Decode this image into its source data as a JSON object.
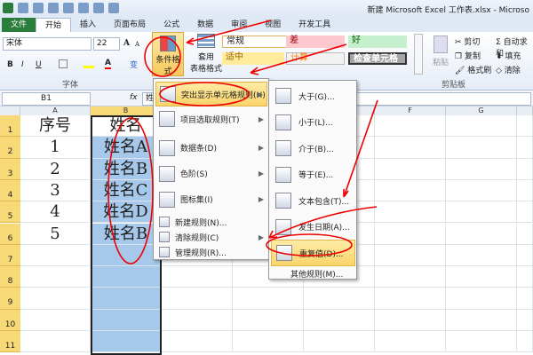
{
  "window": {
    "title": "新建 Microsoft Excel 工作表.xlsx - Microso"
  },
  "tabs": [
    "文件",
    "开始",
    "插入",
    "页面布局",
    "公式",
    "数据",
    "审阅",
    "视图",
    "开发工具"
  ],
  "ribbon": {
    "font_name": "宋体",
    "font_size": "22",
    "bold": "B",
    "italic": "I",
    "underline": "U",
    "font_color": "A",
    "grow": "A",
    "shrink": "A",
    "phonetic": "变",
    "font_group": "字体",
    "cond_format": "条件格式",
    "table_format_1": "套用",
    "table_format_2": "表格格式",
    "styles": {
      "normal": "常规",
      "bad": "差",
      "good": "好",
      "neutral": "适中",
      "calc": "计算",
      "check": "检查单元格"
    },
    "paste": "粘贴",
    "cut": "剪切",
    "copy": "复制",
    "format_painter": "格式刷",
    "clipboard_group": "剪贴板",
    "autosum": "自动求和",
    "fill": "填充",
    "clear": "清除"
  },
  "formula_bar": {
    "name_box": "B1",
    "fx": "fx",
    "content": "姓"
  },
  "columns": [
    "A",
    "B",
    "F",
    "G"
  ],
  "rows": [
    "1",
    "2",
    "3",
    "4",
    "5",
    "6",
    "7",
    "8",
    "9",
    "10",
    "11"
  ],
  "cells": {
    "A": [
      "序号",
      "1",
      "2",
      "3",
      "4",
      "5"
    ],
    "B": [
      "姓名",
      "姓名A",
      "姓名B",
      "姓名C",
      "姓名D",
      "姓名B"
    ]
  },
  "menu": [
    "突出显示单元格规则(H)",
    "项目选取规则(T)",
    "数据条(D)",
    "色阶(S)",
    "图标集(I)",
    "新建规则(N)...",
    "清除规则(C)",
    "管理规则(R)..."
  ],
  "submenu": [
    "大于(G)...",
    "小于(L)...",
    "介于(B)...",
    "等于(E)...",
    "文本包含(T)...",
    "发生日期(A)...",
    "重复值(D)...",
    "其他规则(M)..."
  ],
  "colors": {
    "accent": "#2a7d3b",
    "selection": "#a6c8ea",
    "annotation": "#e00000"
  }
}
